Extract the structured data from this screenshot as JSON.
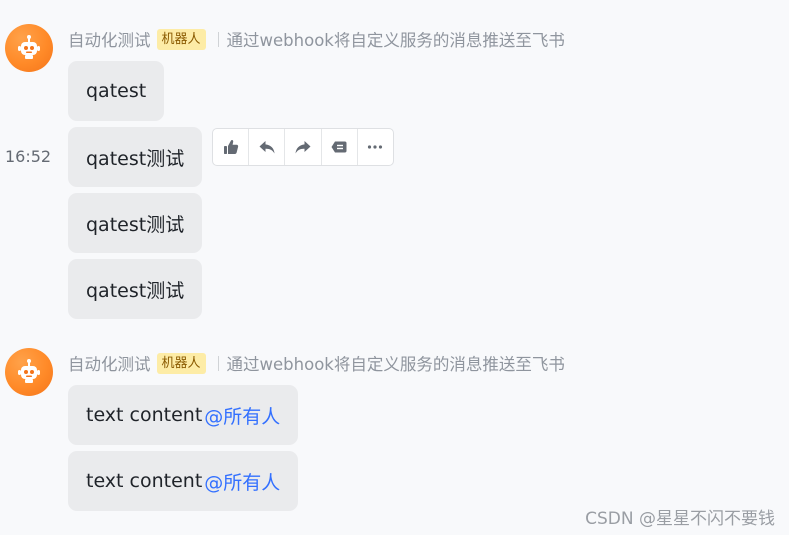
{
  "colors": {
    "avatar": "#ff8a28",
    "badge_bg": "#fdeca6",
    "mention": "#3370ff",
    "bubble_bg": "#eaebed"
  },
  "groups": [
    {
      "sender": "自动化测试",
      "badge": "机器人",
      "description": "通过webhook将自定义服务的消息推送至飞书",
      "avatar_icon": "robot-icon",
      "messages": [
        {
          "text": "qatest"
        },
        {
          "text": "qatest测试"
        },
        {
          "text": "qatest测试"
        },
        {
          "text": "qatest测试"
        }
      ]
    },
    {
      "sender": "自动化测试",
      "badge": "机器人",
      "description": "通过webhook将自定义服务的消息推送至飞书",
      "avatar_icon": "robot-icon",
      "messages": [
        {
          "text": "text content",
          "mention": "@所有人"
        },
        {
          "text": "text content",
          "mention": "@所有人"
        }
      ]
    }
  ],
  "hover": {
    "timestamp": "16:52",
    "toolbar": [
      {
        "icon": "thumbs-up-icon"
      },
      {
        "icon": "reply-icon"
      },
      {
        "icon": "forward-icon"
      },
      {
        "icon": "delete-icon"
      },
      {
        "icon": "more-icon"
      }
    ]
  },
  "watermark": "CSDN @星星不闪不要钱"
}
